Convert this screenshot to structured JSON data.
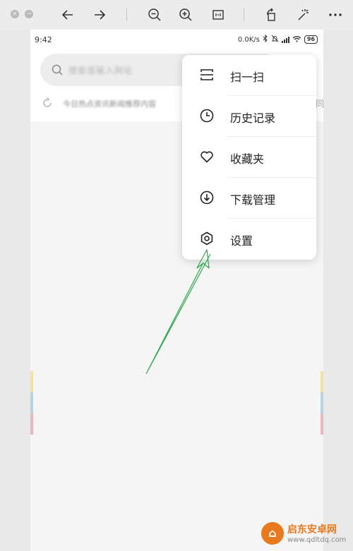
{
  "status_bar": {
    "time": "9:42",
    "network_speed": "0.0K/s",
    "battery": "96"
  },
  "search": {
    "placeholder": "搜索或输入网址"
  },
  "hot_row": {
    "text": "今日热点资讯新闻推荐内容",
    "tail": "同"
  },
  "menu": {
    "items": [
      {
        "label": "扫一扫",
        "icon": "scan-icon"
      },
      {
        "label": "历史记录",
        "icon": "clock-icon"
      },
      {
        "label": "收藏夹",
        "icon": "heart-icon"
      },
      {
        "label": "下载管理",
        "icon": "download-icon"
      },
      {
        "label": "设置",
        "icon": "gear-icon"
      }
    ]
  },
  "annotation": {
    "arrow_color": "#2ea84e"
  },
  "watermark": {
    "title": "启东安卓网",
    "url": "www.qdltdq.com"
  },
  "colors": {
    "accent_stripes": [
      "#f3e3a3",
      "#b8d3e5",
      "#e8b8bd"
    ]
  }
}
